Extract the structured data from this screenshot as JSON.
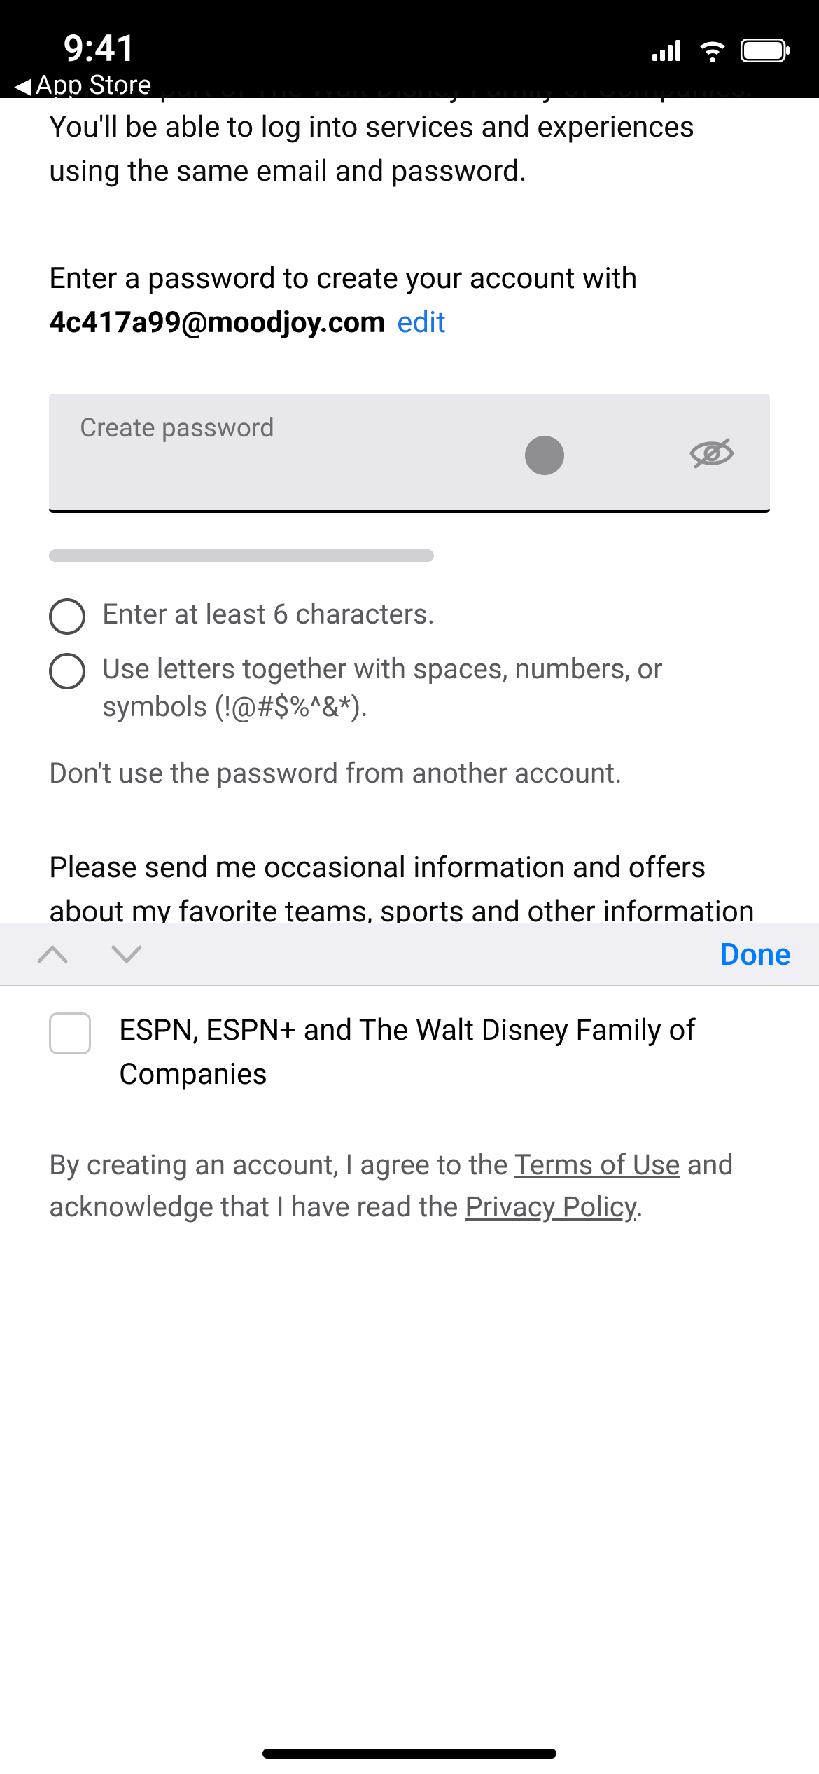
{
  "status": {
    "time": "9:41",
    "back_label": "App Store"
  },
  "intro": {
    "line_cut": "ESPN is part of The Walt Disney Family of Companies.",
    "line2": "You'll be able to log into services and experiences using the same email and password."
  },
  "prompt": {
    "text": "Enter a password to create your account with",
    "email": "4c417a99@moodjoy.com",
    "edit_label": "edit"
  },
  "password": {
    "label": "Create password"
  },
  "requirements": {
    "r1": "Enter at least 6 characters.",
    "r2": "Use letters together with spaces, numbers, or symbols (!@#$%^&*).",
    "warn": "Don't use the password from another account."
  },
  "marketing": {
    "intro": "Please send me occasional information and offers about my favorite teams, sports and other information"
  },
  "keyboard_bar": {
    "done": "Done"
  },
  "checkbox": {
    "label": "ESPN, ESPN+ and The Walt Disney Family of Companies"
  },
  "legal": {
    "pre": "By creating an account, I agree to the ",
    "tou": "Terms of Use",
    "mid": " and acknowledge that I have read the ",
    "pp": "Privacy Policy",
    "end": "."
  }
}
